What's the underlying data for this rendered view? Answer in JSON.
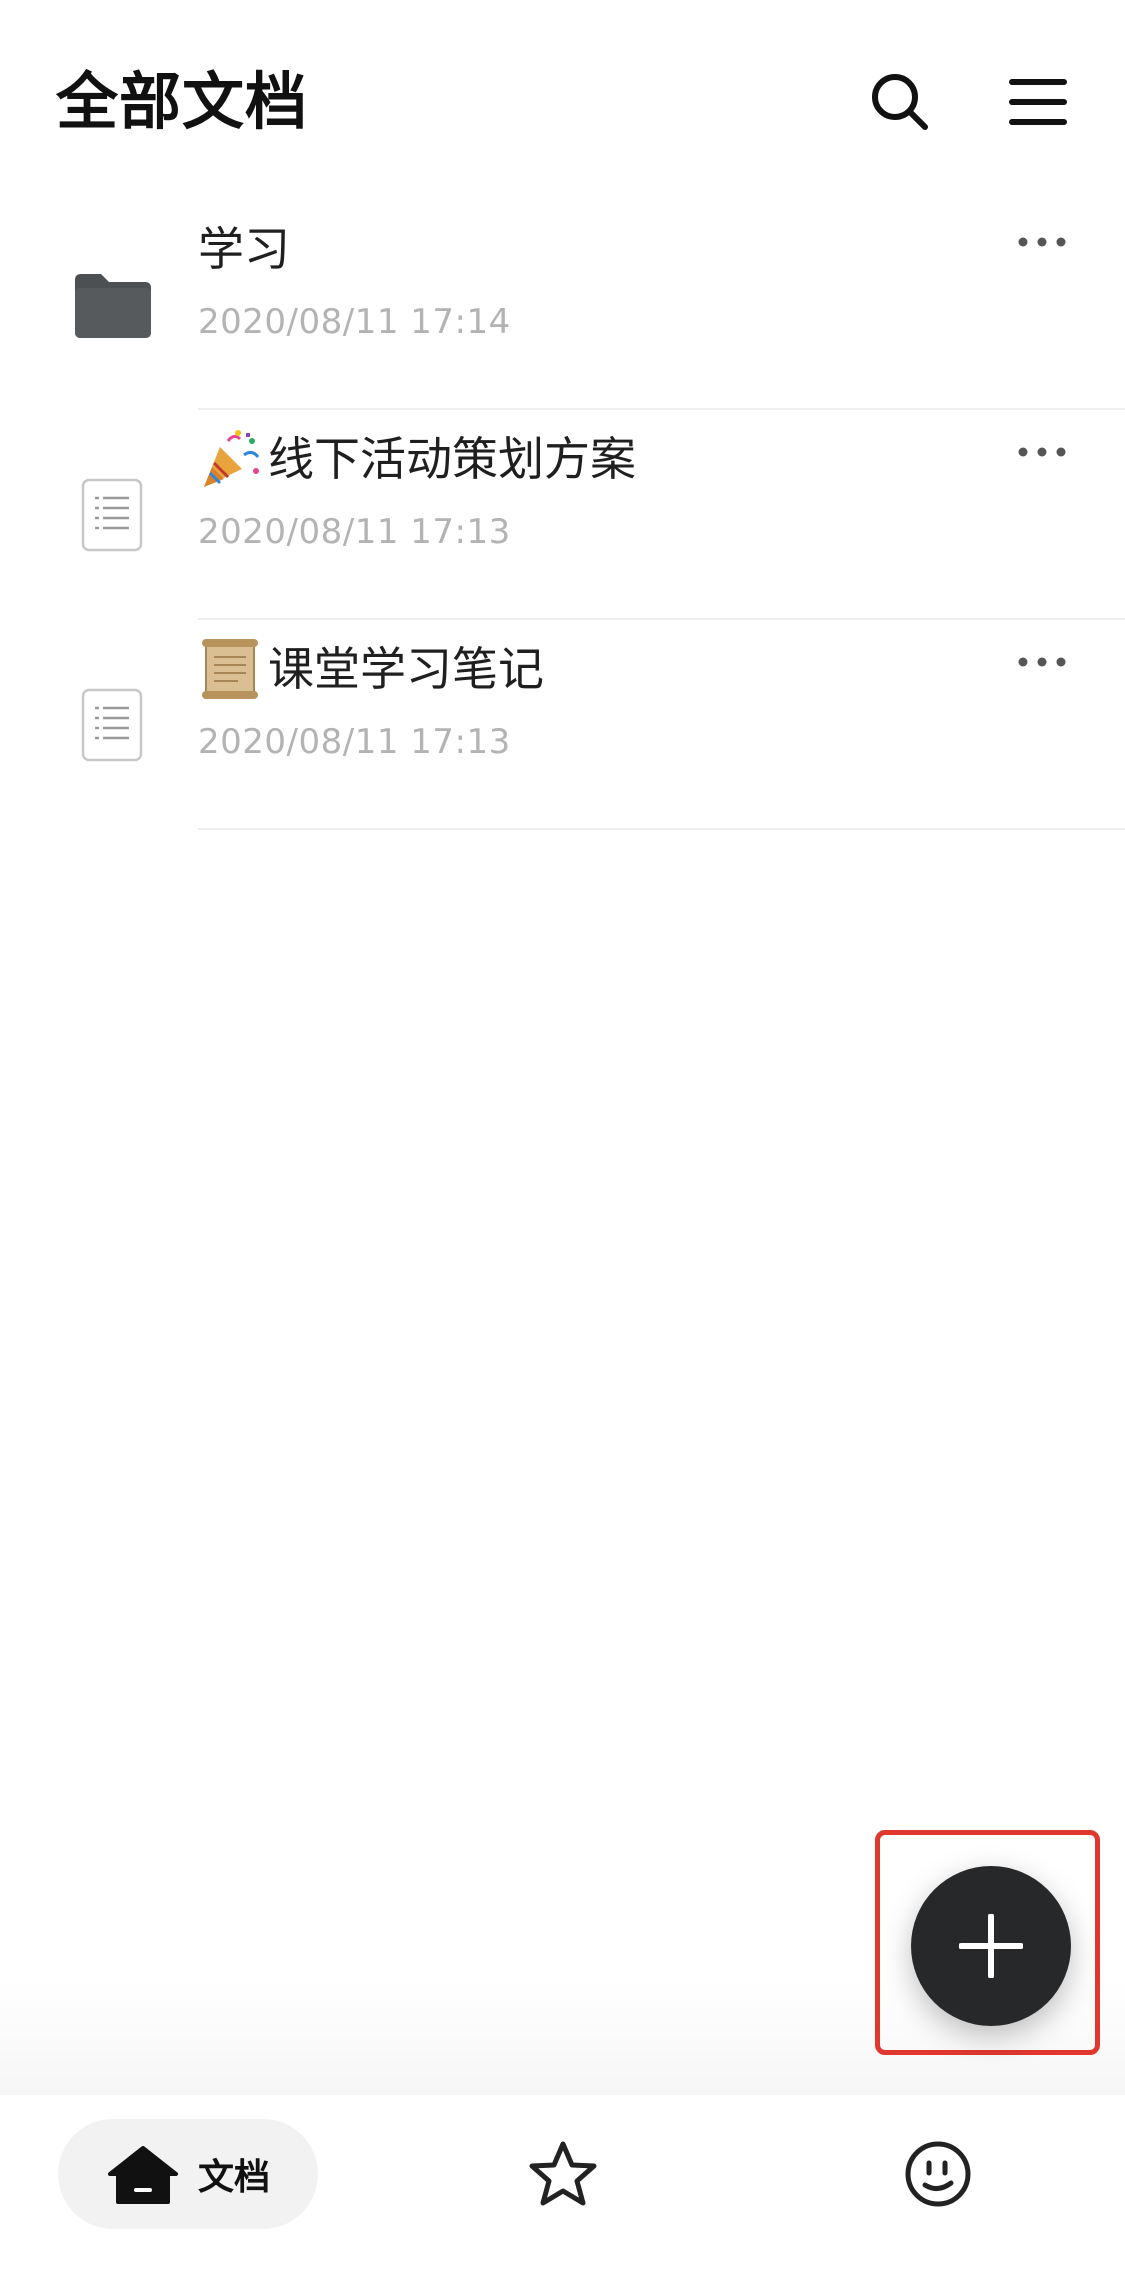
{
  "header": {
    "title": "全部文档"
  },
  "icons": {
    "search": "search-icon",
    "menu": "hamburger-menu-icon",
    "folder": "folder-icon",
    "document": "document-icon",
    "more": "more-horizontal-icon",
    "plus": "plus-icon",
    "home": "home-icon",
    "star": "star-icon",
    "smiley": "smiley-face-icon"
  },
  "documents": [
    {
      "type": "folder",
      "title": "学习",
      "date": "2020/08/11 17:14",
      "emoji": ""
    },
    {
      "type": "document",
      "title": "线下活动策划方案",
      "date": "2020/08/11 17:13",
      "emoji": "party-popper"
    },
    {
      "type": "document",
      "title": "课堂学习笔记",
      "date": "2020/08/11 17:13",
      "emoji": "scroll"
    }
  ],
  "tabbar": {
    "docs_label": "文档"
  },
  "colors": {
    "fab": "#262829",
    "highlight": "#e0382f",
    "date_text": "#b3b3b3",
    "folder": "#4d5052"
  }
}
